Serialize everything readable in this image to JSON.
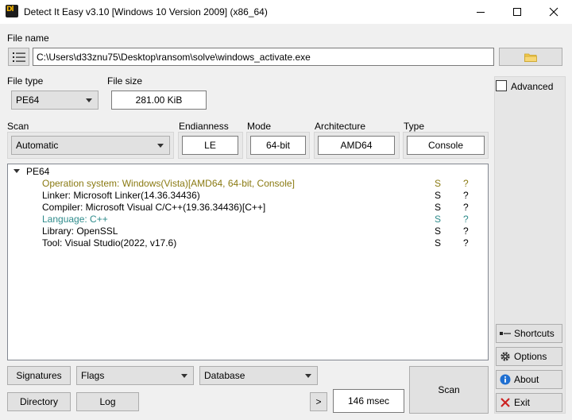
{
  "window": {
    "title": "Detect It Easy v3.10 [Windows 10 Version 2009] (x86_64)",
    "icon_label": "Dl"
  },
  "file": {
    "label": "File name",
    "path": "C:\\Users\\d33znu75\\Desktop\\ransom\\solve\\windows_activate.exe"
  },
  "filetype": {
    "label": "File type",
    "value": "PE64"
  },
  "filesize": {
    "label": "File size",
    "value": "281.00 KiB"
  },
  "scan": {
    "label": "Scan",
    "value": "Automatic"
  },
  "endianness": {
    "label": "Endianness",
    "value": "LE"
  },
  "mode": {
    "label": "Mode",
    "value": "64-bit"
  },
  "architecture": {
    "label": "Architecture",
    "value": "AMD64"
  },
  "type": {
    "label": "Type",
    "value": "Console"
  },
  "advanced": {
    "label": "Advanced",
    "checked": false
  },
  "results": {
    "root": "PE64",
    "rows": [
      {
        "text": "Operation system: Windows(Vista)[AMD64, 64-bit, Console]",
        "s": "S",
        "q": "?",
        "color": "#8a7a12"
      },
      {
        "text": "Linker: Microsoft Linker(14.36.34436)",
        "s": "S",
        "q": "?",
        "color": "#000000"
      },
      {
        "text": "Compiler: Microsoft Visual C/C++(19.36.34436)[C++]",
        "s": "S",
        "q": "?",
        "color": "#000000"
      },
      {
        "text": "Language: C++",
        "s": "S",
        "q": "?",
        "color": "#2e8b8b"
      },
      {
        "text": "Library: OpenSSL",
        "s": "S",
        "q": "?",
        "color": "#000000"
      },
      {
        "text": "Tool: Visual Studio(2022, v17.6)",
        "s": "S",
        "q": "?",
        "color": "#000000"
      }
    ]
  },
  "side_buttons": {
    "shortcuts": "Shortcuts",
    "options": "Options",
    "about": "About",
    "exit": "Exit"
  },
  "bottom": {
    "signatures": "Signatures",
    "flags": "Flags",
    "database": "Database",
    "directory": "Directory",
    "log": "Log",
    "more": ">",
    "time": "146 msec",
    "scan": "Scan"
  }
}
